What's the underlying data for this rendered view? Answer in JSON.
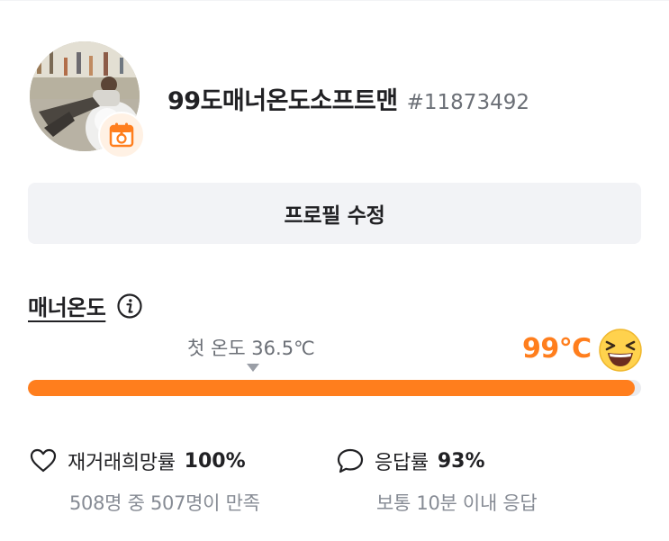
{
  "profile": {
    "nickname": "99도매너온도소프트맨",
    "user_id": "#11873492",
    "avatar_icon": "user-photo",
    "badge_icon": "calendar-badge-icon"
  },
  "edit_button": {
    "label": "프로필 수정"
  },
  "manner": {
    "title": "매너온도",
    "info_icon": "info-icon",
    "first_temperature_label": "첫 온도 36.5℃",
    "current_temperature": "99℃",
    "current_value": 99,
    "max_value": 100,
    "emoji_icon": "laughing-face-icon",
    "accent_color": "#ff7e1d"
  },
  "stats": {
    "rehire": {
      "icon": "heart-outline-icon",
      "label": "재거래희망률",
      "value": "100%",
      "sub": "508명 중 507명이 만족"
    },
    "response": {
      "icon": "speech-bubble-icon",
      "label": "응답률",
      "value": "93%",
      "sub": "보통 10분 이내 응답"
    }
  }
}
